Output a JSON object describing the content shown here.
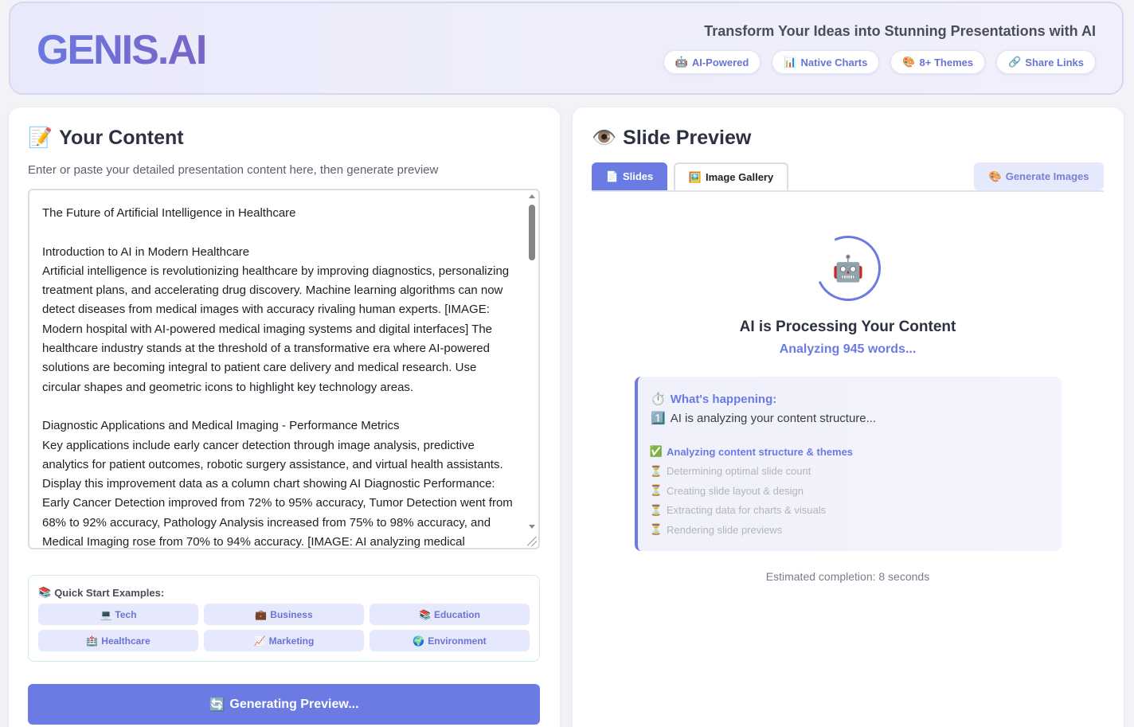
{
  "header": {
    "logo": "GENIS.AI",
    "tagline": "Transform Your Ideas into Stunning Presentations with AI",
    "pills": [
      {
        "icon": "robot-icon",
        "glyph": "🤖",
        "label": "AI-Powered"
      },
      {
        "icon": "chart-icon",
        "glyph": "📊",
        "label": "Native Charts"
      },
      {
        "icon": "palette-icon",
        "glyph": "🎨",
        "label": "8+ Themes"
      },
      {
        "icon": "link-icon",
        "glyph": "🔗",
        "label": "Share Links"
      }
    ]
  },
  "content": {
    "title_icon": "📝",
    "title": "Your Content",
    "subtitle": "Enter or paste your detailed presentation content here, then generate preview",
    "text": "The Future of Artificial Intelligence in Healthcare\n\nIntroduction to AI in Modern Healthcare\nArtificial intelligence is revolutionizing healthcare by improving diagnostics, personalizing treatment plans, and accelerating drug discovery. Machine learning algorithms can now detect diseases from medical images with accuracy rivaling human experts. [IMAGE: Modern hospital with AI-powered medical imaging systems and digital interfaces] The healthcare industry stands at the threshold of a transformative era where AI-powered solutions are becoming integral to patient care delivery and medical research. Use circular shapes and geometric icons to highlight key technology areas.\n\nDiagnostic Applications and Medical Imaging - Performance Metrics\nKey applications include early cancer detection through image analysis, predictive analytics for patient outcomes, robotic surgery assistance, and virtual health assistants. Display this improvement data as a column chart showing AI Diagnostic Performance: Early Cancer Detection improved from 72% to 95% accuracy, Tumor Detection went from 68% to 92% accuracy, Pathology Analysis increased from 75% to 98% accuracy, and Medical Imaging rose from 70% to 94% accuracy. [IMAGE: AI analyzing medical",
    "quick_start": {
      "icon": "📚",
      "label": "Quick Start Examples:",
      "items": [
        {
          "glyph": "💻",
          "label": "Tech"
        },
        {
          "glyph": "💼",
          "label": "Business"
        },
        {
          "glyph": "📚",
          "label": "Education"
        },
        {
          "glyph": "🏥",
          "label": "Healthcare"
        },
        {
          "glyph": "📈",
          "label": "Marketing"
        },
        {
          "glyph": "🌍",
          "label": "Environment"
        }
      ]
    },
    "generate_icon": "🔄",
    "generate_label": "Generating Preview..."
  },
  "preview": {
    "title_icon": "👁️",
    "title": "Slide Preview",
    "tabs": {
      "slides_icon": "📄",
      "slides": "Slides",
      "gallery_icon": "🖼️",
      "gallery": "Image Gallery",
      "generate_icon": "🎨",
      "generate": "Generate Images"
    },
    "robot_glyph": "🤖",
    "processing_title": "AI is Processing Your Content",
    "processing_sub": "Analyzing 945 words...",
    "status": {
      "head_icon": "⏱️",
      "head": "What's happening:",
      "current_icon": "1️⃣",
      "current": "AI is analyzing your content structure...",
      "steps": [
        {
          "glyph": "✅",
          "label": "Analyzing content structure & themes",
          "active": true
        },
        {
          "glyph": "⏳",
          "label": "Determining optimal slide count",
          "active": false
        },
        {
          "glyph": "⏳",
          "label": "Creating slide layout & design",
          "active": false
        },
        {
          "glyph": "⏳",
          "label": "Extracting data for charts & visuals",
          "active": false
        },
        {
          "glyph": "⏳",
          "label": "Rendering slide previews",
          "active": false
        }
      ]
    },
    "eta": "Estimated completion: 8 seconds"
  },
  "colors": {
    "accent": "#6b7be3",
    "accent_light": "#e6e8fb",
    "text": "#2d3142"
  }
}
